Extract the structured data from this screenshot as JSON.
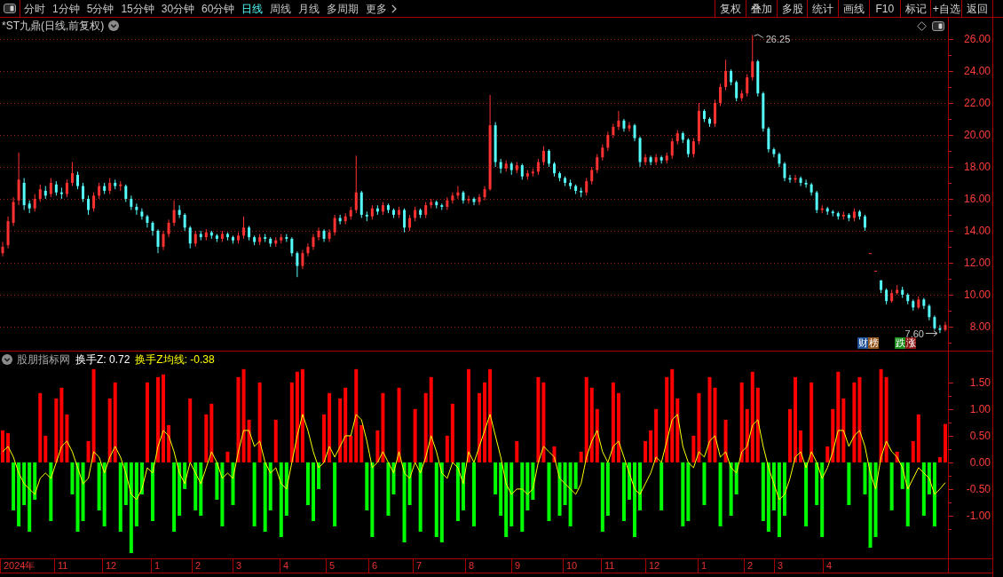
{
  "toolbar": {
    "periods": [
      {
        "label": "分时",
        "selected": false,
        "kind": "tab"
      },
      {
        "label": "1分钟",
        "selected": false,
        "kind": "tab"
      },
      {
        "label": "5分钟",
        "selected": false,
        "kind": "tab"
      },
      {
        "label": "15分钟",
        "selected": false,
        "kind": "tab"
      },
      {
        "label": "30分钟",
        "selected": false,
        "kind": "tab"
      },
      {
        "label": "60分钟",
        "selected": false,
        "kind": "tab"
      },
      {
        "label": "日线",
        "selected": true,
        "kind": "tab"
      },
      {
        "label": "周线",
        "selected": false,
        "kind": "tab"
      },
      {
        "label": "月线",
        "selected": false,
        "kind": "tab"
      },
      {
        "label": "多周期",
        "selected": false,
        "kind": "tab"
      },
      {
        "label": "更多",
        "selected": false,
        "kind": "menu"
      }
    ],
    "buttons": [
      "复权",
      "叠加",
      "多股",
      "统计",
      "画线",
      "F10",
      "标记",
      "+自选",
      "返回"
    ]
  },
  "price_pane": {
    "title": "*ST九鼎(日线,前复权)",
    "chart_data": [
      {
        "type": "candlestick",
        "grid": true,
        "ylim": [
          6.5,
          26.33
        ],
        "yticks": [
          {
            "value": 26,
            "label": "26.00"
          },
          {
            "value": 24,
            "label": "24.00"
          },
          {
            "value": 22,
            "label": "22.00"
          },
          {
            "value": 20,
            "label": "20.00"
          },
          {
            "value": 18,
            "label": "18.00"
          },
          {
            "value": 16,
            "label": "16.00"
          },
          {
            "value": 14,
            "label": "14.00"
          },
          {
            "value": 12,
            "label": "12.00"
          },
          {
            "value": 10,
            "label": "10.00"
          },
          {
            "value": 8,
            "label": "8.00"
          }
        ],
        "annotations": [
          "26.25",
          "7.60"
        ],
        "ohlc": [
          [
            12.6,
            13.3,
            12.4,
            13.0
          ],
          [
            13.1,
            14.9,
            12.9,
            14.6
          ],
          [
            14.5,
            16.1,
            14.3,
            15.8
          ],
          [
            15.9,
            18.9,
            15.6,
            17.2
          ],
          [
            17.0,
            17.3,
            15.3,
            15.6
          ],
          [
            15.7,
            15.9,
            15.1,
            15.4
          ],
          [
            15.4,
            16.3,
            15.2,
            16.0
          ],
          [
            16.0,
            16.9,
            15.8,
            16.6
          ],
          [
            16.5,
            16.8,
            16.0,
            16.2
          ],
          [
            16.3,
            17.3,
            16.1,
            17.0
          ],
          [
            16.9,
            17.1,
            16.2,
            16.4
          ],
          [
            16.4,
            16.7,
            16.0,
            16.3
          ],
          [
            16.3,
            17.2,
            16.1,
            17.0
          ],
          [
            17.0,
            18.3,
            16.8,
            17.6
          ],
          [
            17.5,
            17.7,
            16.6,
            16.8
          ],
          [
            16.8,
            17.0,
            15.8,
            16.0
          ],
          [
            16.0,
            16.2,
            15.0,
            15.3
          ],
          [
            15.4,
            16.4,
            15.2,
            16.2
          ],
          [
            16.2,
            17.0,
            16.0,
            16.8
          ],
          [
            16.8,
            17.0,
            16.3,
            16.5
          ],
          [
            16.5,
            17.3,
            16.3,
            17.0
          ],
          [
            17.0,
            17.2,
            16.6,
            16.8
          ],
          [
            16.8,
            17.1,
            16.5,
            16.9
          ],
          [
            16.8,
            16.9,
            15.8,
            16.0
          ],
          [
            16.0,
            16.2,
            15.3,
            15.5
          ],
          [
            15.5,
            15.7,
            15.0,
            15.3
          ],
          [
            15.2,
            15.4,
            14.7,
            14.9
          ],
          [
            14.9,
            15.0,
            14.2,
            14.5
          ],
          [
            14.5,
            14.6,
            13.7,
            14.0
          ],
          [
            14.0,
            14.1,
            12.6,
            13.0
          ],
          [
            13.0,
            14.0,
            12.8,
            13.8
          ],
          [
            13.8,
            14.7,
            13.6,
            14.5
          ],
          [
            14.5,
            15.9,
            14.3,
            15.3
          ],
          [
            15.3,
            15.6,
            14.8,
            15.0
          ],
          [
            15.0,
            15.1,
            14.0,
            14.2
          ],
          [
            14.2,
            14.3,
            12.9,
            13.2
          ],
          [
            13.2,
            14.0,
            13.0,
            13.8
          ],
          [
            13.8,
            14.0,
            13.4,
            13.6
          ],
          [
            13.6,
            14.1,
            13.4,
            13.9
          ],
          [
            13.9,
            14.0,
            13.5,
            13.7
          ],
          [
            13.7,
            13.8,
            13.3,
            13.5
          ],
          [
            13.5,
            14.0,
            13.3,
            13.8
          ],
          [
            13.8,
            13.9,
            13.4,
            13.6
          ],
          [
            13.6,
            13.7,
            13.2,
            13.4
          ],
          [
            13.4,
            13.9,
            13.2,
            13.7
          ],
          [
            13.7,
            14.9,
            13.5,
            14.2
          ],
          [
            14.2,
            14.3,
            13.4,
            13.6
          ],
          [
            13.6,
            13.7,
            13.1,
            13.3
          ],
          [
            13.3,
            13.8,
            13.1,
            13.6
          ],
          [
            13.6,
            13.8,
            13.3,
            13.5
          ],
          [
            13.5,
            13.6,
            13.0,
            13.2
          ],
          [
            13.2,
            13.6,
            13.0,
            13.4
          ],
          [
            13.4,
            13.8,
            13.2,
            13.6
          ],
          [
            13.6,
            13.8,
            13.3,
            13.5
          ],
          [
            13.5,
            13.6,
            12.4,
            12.6
          ],
          [
            12.6,
            12.7,
            11.1,
            11.8
          ],
          [
            11.8,
            12.8,
            11.6,
            12.6
          ],
          [
            12.6,
            13.2,
            12.4,
            13.0
          ],
          [
            13.0,
            13.8,
            12.8,
            13.6
          ],
          [
            13.6,
            14.2,
            13.4,
            14.0
          ],
          [
            14.0,
            14.1,
            13.3,
            13.5
          ],
          [
            13.5,
            14.1,
            13.3,
            13.9
          ],
          [
            13.9,
            15.0,
            13.7,
            14.8
          ],
          [
            14.8,
            15.0,
            14.4,
            14.6
          ],
          [
            14.6,
            15.1,
            14.4,
            14.9
          ],
          [
            14.9,
            15.5,
            14.7,
            15.3
          ],
          [
            15.3,
            18.7,
            15.1,
            16.4
          ],
          [
            16.4,
            16.5,
            14.8,
            15.0
          ],
          [
            15.0,
            15.2,
            14.6,
            14.9
          ],
          [
            14.9,
            15.6,
            14.7,
            15.4
          ],
          [
            15.4,
            15.6,
            15.0,
            15.2
          ],
          [
            15.2,
            15.8,
            15.0,
            15.6
          ],
          [
            15.6,
            15.7,
            15.1,
            15.3
          ],
          [
            15.3,
            15.4,
            14.8,
            15.0
          ],
          [
            15.0,
            15.5,
            14.8,
            15.3
          ],
          [
            15.3,
            15.4,
            13.9,
            14.2
          ],
          [
            14.2,
            15.0,
            14.0,
            14.8
          ],
          [
            14.8,
            15.5,
            14.6,
            15.3
          ],
          [
            15.3,
            15.4,
            14.8,
            15.0
          ],
          [
            15.0,
            15.8,
            14.8,
            15.6
          ],
          [
            15.6,
            16.0,
            15.4,
            15.8
          ],
          [
            15.8,
            15.9,
            15.4,
            15.6
          ],
          [
            15.6,
            15.7,
            15.3,
            15.5
          ],
          [
            15.5,
            16.1,
            15.3,
            15.9
          ],
          [
            15.9,
            16.4,
            15.7,
            16.2
          ],
          [
            16.2,
            16.8,
            16.0,
            16.4
          ],
          [
            16.4,
            16.5,
            15.7,
            15.9
          ],
          [
            15.9,
            16.2,
            15.7,
            16.0
          ],
          [
            16.0,
            16.1,
            15.6,
            15.8
          ],
          [
            15.8,
            16.3,
            15.6,
            16.1
          ],
          [
            16.1,
            16.8,
            15.9,
            16.6
          ],
          [
            16.6,
            22.5,
            16.5,
            20.6
          ],
          [
            20.6,
            20.8,
            18.0,
            18.3
          ],
          [
            18.3,
            18.5,
            17.6,
            17.9
          ],
          [
            17.9,
            18.4,
            17.7,
            18.2
          ],
          [
            18.2,
            18.3,
            17.5,
            17.8
          ],
          [
            17.8,
            18.3,
            17.6,
            18.1
          ],
          [
            18.1,
            18.2,
            17.2,
            17.4
          ],
          [
            17.4,
            17.8,
            17.2,
            17.6
          ],
          [
            17.6,
            17.9,
            17.4,
            17.7
          ],
          [
            17.7,
            18.5,
            17.5,
            18.3
          ],
          [
            18.3,
            19.3,
            18.1,
            19.0
          ],
          [
            19.0,
            19.1,
            18.0,
            18.2
          ],
          [
            18.2,
            18.3,
            17.4,
            17.6
          ],
          [
            17.6,
            17.7,
            17.1,
            17.3
          ],
          [
            17.3,
            17.4,
            16.8,
            17.0
          ],
          [
            17.0,
            17.2,
            16.6,
            16.8
          ],
          [
            16.8,
            16.9,
            16.3,
            16.5
          ],
          [
            16.5,
            16.7,
            16.1,
            16.4
          ],
          [
            16.4,
            17.3,
            16.2,
            17.1
          ],
          [
            17.1,
            18.0,
            16.9,
            17.8
          ],
          [
            17.8,
            18.8,
            17.6,
            18.6
          ],
          [
            18.6,
            19.4,
            18.4,
            19.2
          ],
          [
            19.2,
            20.2,
            19.0,
            20.0
          ],
          [
            20.0,
            20.7,
            19.8,
            20.5
          ],
          [
            20.5,
            21.5,
            20.3,
            20.9
          ],
          [
            20.9,
            21.0,
            20.2,
            20.4
          ],
          [
            20.4,
            20.8,
            20.2,
            20.6
          ],
          [
            20.6,
            20.7,
            19.6,
            19.8
          ],
          [
            19.8,
            19.9,
            18.0,
            18.3
          ],
          [
            18.3,
            18.8,
            18.1,
            18.6
          ],
          [
            18.6,
            18.7,
            18.1,
            18.3
          ],
          [
            18.3,
            18.8,
            18.1,
            18.6
          ],
          [
            18.6,
            18.7,
            18.2,
            18.4
          ],
          [
            18.4,
            18.9,
            18.2,
            18.7
          ],
          [
            18.7,
            19.8,
            18.5,
            19.6
          ],
          [
            19.6,
            20.3,
            19.4,
            20.1
          ],
          [
            20.1,
            20.2,
            19.5,
            19.7
          ],
          [
            19.7,
            19.8,
            18.6,
            18.8
          ],
          [
            18.8,
            19.8,
            18.6,
            19.6
          ],
          [
            19.6,
            22.0,
            19.4,
            21.5
          ],
          [
            21.5,
            21.6,
            20.8,
            21.0
          ],
          [
            21.0,
            21.1,
            20.5,
            20.7
          ],
          [
            20.7,
            22.2,
            20.5,
            22.0
          ],
          [
            22.0,
            23.2,
            21.8,
            23.0
          ],
          [
            23.0,
            24.7,
            22.8,
            24.0
          ],
          [
            24.0,
            24.1,
            23.1,
            23.3
          ],
          [
            23.3,
            23.4,
            22.1,
            22.3
          ],
          [
            22.3,
            22.8,
            22.1,
            22.6
          ],
          [
            22.6,
            23.8,
            22.4,
            23.6
          ],
          [
            23.6,
            26.25,
            23.4,
            24.6
          ],
          [
            24.6,
            24.7,
            22.4,
            22.6
          ],
          [
            22.6,
            22.7,
            20.2,
            20.4
          ],
          [
            20.4,
            20.5,
            18.9,
            19.1
          ],
          [
            19.1,
            19.2,
            18.6,
            18.8
          ],
          [
            18.8,
            18.9,
            18.0,
            18.2
          ],
          [
            18.2,
            18.3,
            17.1,
            17.3
          ],
          [
            17.3,
            17.5,
            17.0,
            17.2
          ],
          [
            17.2,
            17.5,
            17.0,
            17.3
          ],
          [
            17.3,
            17.4,
            16.8,
            17.0
          ],
          [
            17.0,
            17.2,
            16.7,
            16.9
          ],
          [
            16.9,
            17.0,
            16.2,
            16.4
          ],
          [
            16.4,
            16.5,
            15.1,
            15.3
          ],
          [
            15.3,
            15.6,
            15.1,
            15.4
          ],
          [
            15.4,
            15.5,
            15.0,
            15.2
          ],
          [
            15.2,
            15.3,
            14.9,
            15.1
          ],
          [
            15.1,
            15.2,
            14.7,
            14.9
          ],
          [
            14.9,
            15.2,
            14.7,
            15.0
          ],
          [
            15.0,
            15.1,
            14.6,
            14.8
          ],
          [
            14.8,
            15.4,
            14.6,
            15.2
          ],
          [
            15.2,
            15.3,
            14.7,
            14.9
          ],
          [
            14.9,
            15.0,
            14.0,
            14.2
          ],
          [
            12.6,
            12.6,
            12.6,
            12.6
          ],
          [
            11.5,
            11.5,
            11.5,
            11.5
          ],
          [
            10.9,
            10.9,
            10.1,
            10.3
          ],
          [
            10.3,
            10.4,
            9.4,
            9.6
          ],
          [
            9.6,
            10.3,
            9.5,
            10.1
          ],
          [
            10.1,
            10.6,
            10.0,
            10.3
          ],
          [
            10.3,
            10.5,
            9.8,
            10.0
          ],
          [
            10.0,
            10.1,
            9.4,
            9.6
          ],
          [
            9.6,
            9.7,
            9.0,
            9.2
          ],
          [
            9.2,
            9.9,
            9.1,
            9.7
          ],
          [
            9.7,
            9.8,
            9.1,
            9.3
          ],
          [
            9.3,
            9.4,
            8.4,
            8.6
          ],
          [
            8.6,
            8.7,
            7.8,
            7.9
          ],
          [
            7.9,
            8.1,
            7.6,
            7.8
          ],
          [
            7.8,
            8.3,
            7.7,
            8.1
          ]
        ]
      }
    ],
    "tags": [
      {
        "text": "财",
        "color": "#1d4f96"
      },
      {
        "text": "榜",
        "color": "#94561c"
      },
      {
        "text": "跌",
        "color": "#1a8a1a"
      },
      {
        "text": "涨",
        "color": "#8a1414"
      }
    ]
  },
  "indicator_pane": {
    "source": "股朋指标网",
    "readouts": [
      {
        "text": "换手Z: 0.72",
        "color": "#ffffff"
      },
      {
        "text": "换手Z均线: -0.38",
        "color": "#ffff00"
      }
    ],
    "chart_data": [
      {
        "type": "bar",
        "ylim": [
          -1.8,
          1.78
        ],
        "yticks": [
          {
            "value": 1.5,
            "label": "1.50"
          },
          {
            "value": 1,
            "label": "1.00"
          },
          {
            "value": 0.5,
            "label": "0.50"
          },
          {
            "value": 0,
            "label": "0.00"
          },
          {
            "value": -0.5,
            "label": "-0.50"
          },
          {
            "value": -1,
            "label": "-1.00"
          }
        ],
        "series": [
          {
            "type": "bar",
            "values": [
              0.6,
              0.55,
              -0.9,
              -1.2,
              -0.8,
              -1.3,
              -0.7,
              1.3,
              0.5,
              -1.1,
              1.2,
              1.4,
              0.9,
              -0.6,
              -1.3,
              -1.1,
              0.4,
              1.75,
              -0.9,
              -1.2,
              1.2,
              1.5,
              -1.3,
              -0.8,
              -1.7,
              -1.2,
              -0.6,
              1.5,
              -1.1,
              1.6,
              1.65,
              0.7,
              -1.3,
              -1.0,
              -0.5,
              1.2,
              -0.9,
              -1.0,
              0.9,
              1.1,
              -0.7,
              -1.2,
              0.2,
              -0.8,
              1.6,
              1.75,
              0.8,
              -1.2,
              1.5,
              -1.3,
              -0.9,
              0.8,
              -1.4,
              -1.0,
              1.5,
              1.7,
              1.75,
              -0.8,
              -1.1,
              -0.5,
              0.9,
              1.3,
              -1.2,
              1.2,
              1.4,
              0.5,
              1.75,
              0.7,
              -0.9,
              -1.4,
              0.6,
              1.3,
              -1.0,
              -0.6,
              1.4,
              -1.5,
              -0.8,
              1.0,
              -1.3,
              1.3,
              1.6,
              -1.4,
              -1.5,
              0.5,
              1.1,
              -1.1,
              -0.9,
              1.75,
              -1.2,
              1.3,
              1.5,
              1.75,
              -0.6,
              -1.0,
              -1.4,
              -1.2,
              0.4,
              -1.3,
              -0.9,
              -0.7,
              1.6,
              1.5,
              -1.1,
              0.3,
              -1.0,
              -0.8,
              -1.2,
              -0.5,
              0.2,
              1.6,
              1.4,
              1.0,
              -1.3,
              -1.0,
              1.5,
              1.3,
              -1.1,
              -0.7,
              -1.4,
              -0.9,
              0.4,
              0.6,
              1.0,
              -0.9,
              1.6,
              1.75,
              1.2,
              -1.2,
              -1.1,
              0.5,
              1.3,
              -0.8,
              1.6,
              1.4,
              -1.2,
              0.8,
              -1.0,
              -0.6,
              1.5,
              1.0,
              1.7,
              1.4,
              -1.1,
              -1.3,
              -0.9,
              -1.4,
              -1.0,
              1.0,
              1.6,
              0.6,
              -1.2,
              1.5,
              -0.8,
              -1.4,
              0.3,
              1.0,
              1.7,
              1.2,
              -0.8,
              1.5,
              1.6,
              -0.6,
              -1.6,
              -1.4,
              1.75,
              1.6,
              -0.9,
              0.2,
              -0.5,
              -1.2,
              0.4,
              0.9,
              -1.0,
              -0.6,
              -1.2,
              0.1,
              0.72
            ],
            "colors": [
              "#ff0000",
              "#ff0000",
              "#00ff00",
              "#00ff00",
              "#00ff00",
              "#00ff00",
              "#00ff00",
              "#ff0000",
              "#ff0000",
              "#00ff00",
              "#ff0000",
              "#ff0000",
              "#ff0000",
              "#00ff00",
              "#00ff00",
              "#00ff00",
              "#ff0000",
              "#ff0000",
              "#00ff00",
              "#00ff00",
              "#ff0000",
              "#ff0000",
              "#00ff00",
              "#00ff00",
              "#00ff00",
              "#00ff00",
              "#00ff00",
              "#ff0000",
              "#00ff00",
              "#ff0000",
              "#ff0000",
              "#ff0000",
              "#00ff00",
              "#00ff00",
              "#00ff00",
              "#ff0000",
              "#00ff00",
              "#00ff00",
              "#ff0000",
              "#ff0000",
              "#00ff00",
              "#00ff00",
              "#ff0000",
              "#00ff00",
              "#ff0000",
              "#ff0000",
              "#ff0000",
              "#00ff00",
              "#ff0000",
              "#00ff00",
              "#00ff00",
              "#ff0000",
              "#00ff00",
              "#00ff00",
              "#ff0000",
              "#ff0000",
              "#ff0000",
              "#00ff00",
              "#00ff00",
              "#00ff00",
              "#ff0000",
              "#ff0000",
              "#00ff00",
              "#ff0000",
              "#ff0000",
              "#ff0000",
              "#ff0000",
              "#ff0000",
              "#00ff00",
              "#00ff00",
              "#ff0000",
              "#ff0000",
              "#00ff00",
              "#00ff00",
              "#ff0000",
              "#00ff00",
              "#00ff00",
              "#ff0000",
              "#00ff00",
              "#ff0000",
              "#ff0000",
              "#00ff00",
              "#00ff00",
              "#ff0000",
              "#ff0000",
              "#00ff00",
              "#00ff00",
              "#ff0000",
              "#00ff00",
              "#ff0000",
              "#ff0000",
              "#ff0000",
              "#00ff00",
              "#00ff00",
              "#00ff00",
              "#00ff00",
              "#ff0000",
              "#00ff00",
              "#00ff00",
              "#00ff00",
              "#ff0000",
              "#ff0000",
              "#00ff00",
              "#ff0000",
              "#00ff00",
              "#00ff00",
              "#00ff00",
              "#00ff00",
              "#ff0000",
              "#ff0000",
              "#ff0000",
              "#ff0000",
              "#00ff00",
              "#00ff00",
              "#ff0000",
              "#ff0000",
              "#00ff00",
              "#00ff00",
              "#00ff00",
              "#00ff00",
              "#ff0000",
              "#ff0000",
              "#ff0000",
              "#00ff00",
              "#ff0000",
              "#ff0000",
              "#ff0000",
              "#00ff00",
              "#00ff00",
              "#ff0000",
              "#ff0000",
              "#00ff00",
              "#ff0000",
              "#ff0000",
              "#00ff00",
              "#ff0000",
              "#00ff00",
              "#00ff00",
              "#ff0000",
              "#ff0000",
              "#ff0000",
              "#ff0000",
              "#00ff00",
              "#00ff00",
              "#00ff00",
              "#00ff00",
              "#00ff00",
              "#ff0000",
              "#ff0000",
              "#ff0000",
              "#00ff00",
              "#ff0000",
              "#00ff00",
              "#00ff00",
              "#ff0000",
              "#ff0000",
              "#ff0000",
              "#ff0000",
              "#00ff00",
              "#ff0000",
              "#ff0000",
              "#00ff00",
              "#00ff00",
              "#00ff00",
              "#ff0000",
              "#ff0000",
              "#00ff00",
              "#ff0000",
              "#00ff00",
              "#00ff00",
              "#ff0000",
              "#ff0000",
              "#00ff00",
              "#00ff00",
              "#00ff00",
              "#ff0000",
              "#ff0000"
            ]
          },
          {
            "type": "line",
            "color": "#ffff00",
            "values": [
              0.2,
              0.3,
              0.1,
              -0.2,
              -0.4,
              -0.5,
              -0.6,
              -0.3,
              -0.2,
              -0.3,
              0.0,
              0.3,
              0.4,
              0.2,
              -0.1,
              -0.4,
              -0.3,
              0.2,
              0.1,
              -0.2,
              0.1,
              0.3,
              0.1,
              -0.2,
              -0.6,
              -0.7,
              -0.5,
              -0.1,
              -0.2,
              0.3,
              0.6,
              0.5,
              0.2,
              -0.2,
              -0.4,
              0.0,
              -0.2,
              -0.4,
              -0.1,
              0.2,
              0.0,
              -0.3,
              -0.2,
              -0.3,
              0.2,
              0.6,
              0.6,
              0.3,
              0.4,
              0.0,
              -0.2,
              -0.1,
              -0.4,
              -0.5,
              0.0,
              0.5,
              0.9,
              0.6,
              0.2,
              -0.1,
              0.0,
              0.3,
              0.1,
              0.3,
              0.5,
              0.5,
              0.9,
              0.8,
              0.4,
              -0.1,
              0.0,
              0.2,
              0.0,
              -0.2,
              0.2,
              -0.2,
              -0.3,
              0.0,
              -0.2,
              0.1,
              0.5,
              0.2,
              -0.2,
              -0.3,
              0.0,
              -0.1,
              -0.4,
              0.2,
              0.0,
              0.3,
              0.6,
              0.9,
              0.5,
              0.1,
              -0.4,
              -0.6,
              -0.5,
              -0.5,
              -0.6,
              -0.5,
              0.0,
              0.3,
              0.2,
              0.1,
              -0.3,
              -0.4,
              -0.5,
              -0.6,
              -0.4,
              0.1,
              0.4,
              0.6,
              0.2,
              0.0,
              0.3,
              0.4,
              0.1,
              -0.2,
              -0.5,
              -0.6,
              -0.4,
              -0.2,
              0.1,
              0.0,
              0.4,
              0.8,
              0.9,
              0.3,
              0.0,
              -0.1,
              0.2,
              0.1,
              0.4,
              0.5,
              0.1,
              0.2,
              -0.1,
              -0.2,
              0.2,
              0.3,
              0.7,
              0.8,
              0.3,
              -0.1,
              -0.4,
              -0.7,
              -0.6,
              -0.3,
              0.1,
              0.2,
              -0.1,
              0.2,
              0.0,
              -0.3,
              -0.1,
              0.2,
              0.6,
              0.6,
              0.3,
              0.5,
              0.6,
              0.3,
              -0.2,
              -0.5,
              0.1,
              0.4,
              0.2,
              0.1,
              -0.1,
              -0.5,
              -0.3,
              -0.1,
              -0.2,
              -0.3,
              -0.6,
              -0.5,
              -0.38
            ]
          }
        ]
      }
    ]
  },
  "time_axis": [
    "2024年",
    "11",
    "12",
    "1",
    "2",
    "3",
    "4",
    "5",
    "6",
    "7",
    "8",
    "9",
    "10",
    "11",
    "12",
    "1",
    "2",
    "3",
    "4"
  ]
}
